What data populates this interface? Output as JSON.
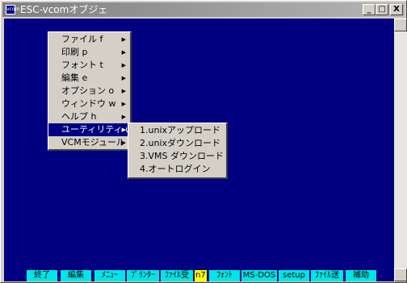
{
  "window": {
    "title": "ESC-vcomオブジェ",
    "app_icon": "vcom",
    "minimize": "_",
    "maximize": "□",
    "close": "X"
  },
  "main_menu": {
    "items": [
      {
        "label": "ファイル f",
        "has_submenu": true
      },
      {
        "label": "印刷 p",
        "has_submenu": true
      },
      {
        "label": "フォント t",
        "has_submenu": true
      },
      {
        "label": "編集 e",
        "has_submenu": true
      },
      {
        "label": "オプション o",
        "has_submenu": true
      },
      {
        "label": "ウィンドウ w",
        "has_submenu": true
      },
      {
        "label": "ヘルプ h",
        "has_submenu": true
      },
      {
        "label": "ユーティリティ u",
        "has_submenu": true,
        "selected": true
      },
      {
        "label": "VCMモジュール",
        "has_submenu": true
      }
    ],
    "arrow": "▶"
  },
  "submenu": {
    "items": [
      {
        "label": "1.unixアップロード"
      },
      {
        "label": "2.unixダウンロード"
      },
      {
        "label": "3.VMS ダウンロード"
      },
      {
        "label": "4.オートログイン"
      }
    ]
  },
  "function_keys": [
    {
      "label": "終了"
    },
    {
      "label": "編集"
    },
    {
      "label": "ﾒﾆｭｰ"
    },
    {
      "label": "ﾌﾟﾘﾝﾀｰ"
    },
    {
      "label": "ﾌｧｲﾙ受"
    },
    {
      "label": "n7",
      "active": true
    },
    {
      "label": "ﾌｫﾝﾄ"
    },
    {
      "label": "MS-DOS"
    },
    {
      "label": "setup"
    },
    {
      "label": "ﾌｧｲﾙ送"
    },
    {
      "label": "補助"
    }
  ],
  "colors": {
    "terminal_bg": "#000080",
    "fkey_bg": "#00e5e5",
    "fkey_active_bg": "#ffff00",
    "menu_selected_bg": "#000080"
  }
}
